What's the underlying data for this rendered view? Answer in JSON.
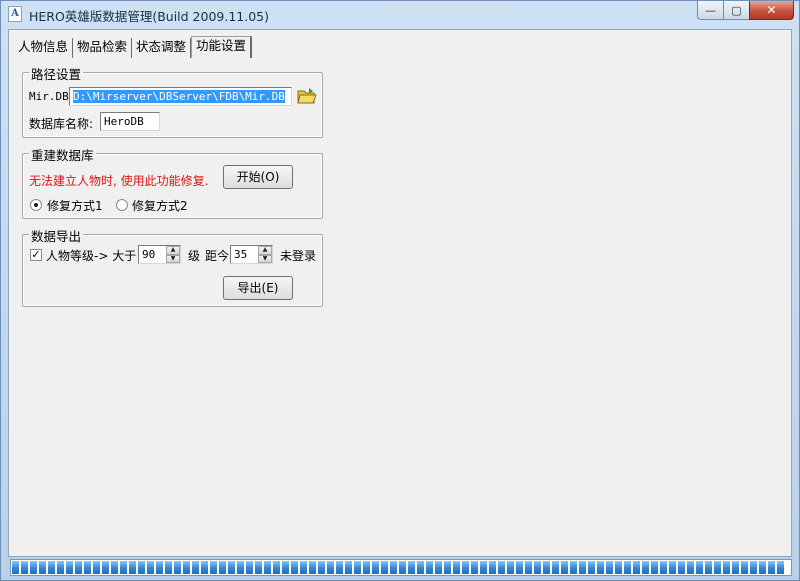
{
  "window": {
    "title": "HERO英雄版数据管理(Build 2009.11.05)",
    "app_icon_glyph": "A"
  },
  "controls": {
    "minimize": "—",
    "maximize": "▢",
    "close": "✕"
  },
  "tabs": [
    {
      "label": "人物信息",
      "active": false
    },
    {
      "label": "物品检索",
      "active": false
    },
    {
      "label": "状态调整",
      "active": false
    },
    {
      "label": "功能设置",
      "active": true
    }
  ],
  "path_group": {
    "title": "路径设置",
    "mirdb_label": "Mir.DB",
    "mirdb_value": "D:\\Mirserver\\DBServer\\FDB\\Mir.DB",
    "dbname_label": "数据库名称:",
    "dbname_value": "HeroDB"
  },
  "rebuild_group": {
    "title": "重建数据库",
    "warning": "无法建立人物时, 使用此功能修复.",
    "start_button": "开始(O)",
    "radio1": "修复方式1",
    "radio2": "修复方式2",
    "radio_selected": 1
  },
  "export_group": {
    "title": "数据导出",
    "checkbox_label": "人物等级-> 大于",
    "checkbox_checked": true,
    "level_value": "90",
    "level_unit": "级",
    "distance_label": "距今",
    "days_value": "35",
    "suffix": "未登录",
    "export_button": "导出(E)"
  },
  "progress": {
    "fraction": 1.0
  }
}
